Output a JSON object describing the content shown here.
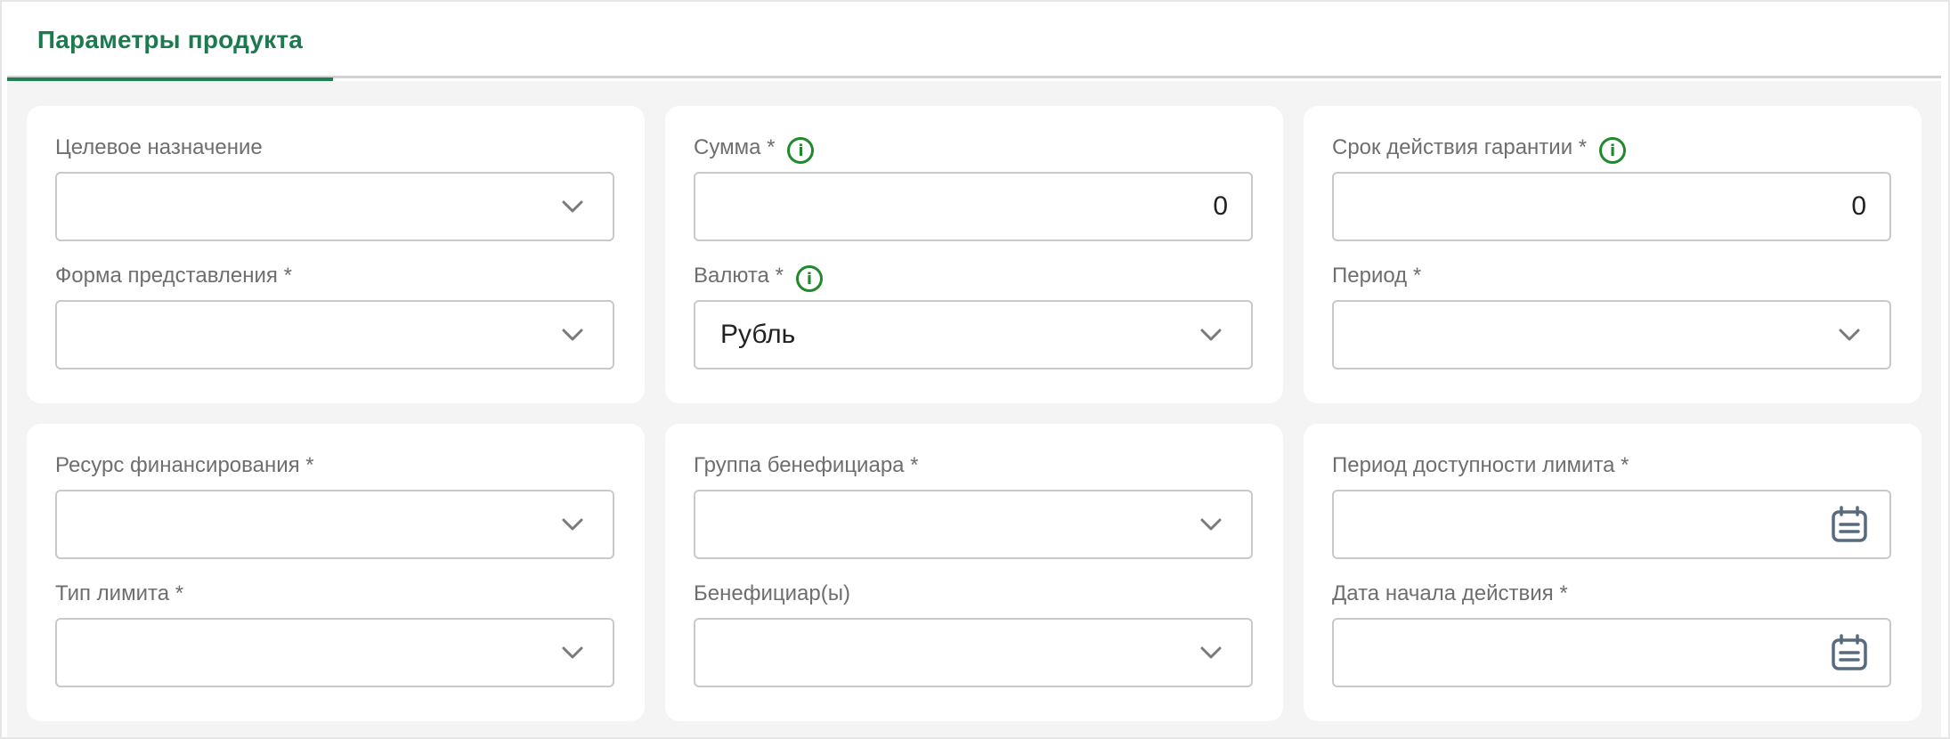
{
  "tabs": [
    {
      "label": "Параметры продукта",
      "active": true
    }
  ],
  "colors": {
    "accent": "#1f7f52",
    "info_icon": "#1e8a2b",
    "label": "#6e6e6e",
    "panel_bg": "#f4f4f4"
  },
  "cards": {
    "purpose": {
      "purpose_field": {
        "label": "Целевое назначение",
        "value": "",
        "icon": "chevron-down-icon"
      },
      "form_field": {
        "label": "Форма представления *",
        "value": "",
        "icon": "chevron-down-icon"
      }
    },
    "amount": {
      "sum_field": {
        "label": "Сумма *",
        "value": "0",
        "info_icon": "info-icon"
      },
      "currency_field": {
        "label": "Валюта *",
        "value": "Рубль",
        "info_icon": "info-icon",
        "icon": "chevron-down-icon"
      }
    },
    "term": {
      "term_field": {
        "label": "Срок действия гарантии *",
        "value": "0",
        "info_icon": "info-icon"
      },
      "period_field": {
        "label": "Период *",
        "value": "",
        "icon": "chevron-down-icon"
      }
    },
    "funding": {
      "resource_field": {
        "label": "Ресурс финансирования *",
        "value": "",
        "icon": "chevron-down-icon"
      },
      "limit_type_field": {
        "label": "Тип лимита *",
        "value": "",
        "icon": "chevron-down-icon"
      }
    },
    "beneficiary": {
      "group_field": {
        "label": "Группа бенефициара *",
        "value": "",
        "icon": "chevron-down-icon"
      },
      "beneficiary_field": {
        "label": "Бенефициар(ы)",
        "value": "",
        "icon": "chevron-down-icon"
      }
    },
    "dates": {
      "limit_period_field": {
        "label": "Период доступности лимита *",
        "value": "",
        "icon": "calendar-icon"
      },
      "start_date_field": {
        "label": "Дата начала действия *",
        "value": "",
        "icon": "calendar-icon"
      }
    }
  }
}
